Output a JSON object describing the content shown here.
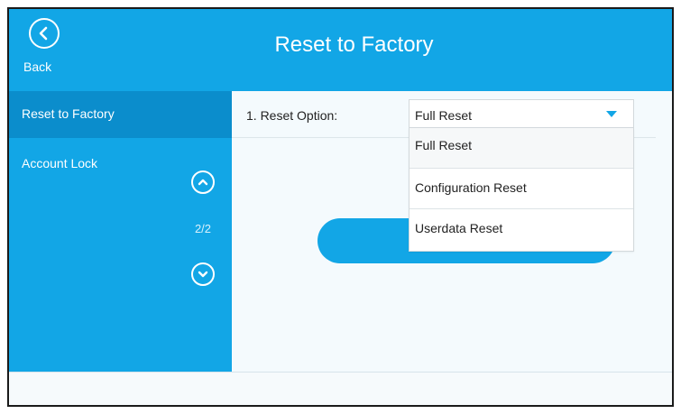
{
  "header": {
    "back_label": "Back",
    "title": "Reset to Factory",
    "back_icon": "chevron-left-circle-icon"
  },
  "sidebar": {
    "items": [
      {
        "label": "Reset to Factory",
        "active": true
      },
      {
        "label": "Account Lock",
        "active": false
      }
    ],
    "pager": {
      "count": "2/2",
      "up_icon": "chevron-up-circle-icon",
      "down_icon": "chevron-down-circle-icon"
    }
  },
  "content": {
    "option_label": "1. Reset Option:",
    "select_value": "Full Reset",
    "dropdown_options": [
      "Full Reset",
      "Configuration Reset",
      "Userdata Reset"
    ],
    "selected_index": 0
  },
  "colors": {
    "accent": "#12a6e6",
    "sidebar_active": "#0b8dcc",
    "background": "#f4fafd"
  }
}
